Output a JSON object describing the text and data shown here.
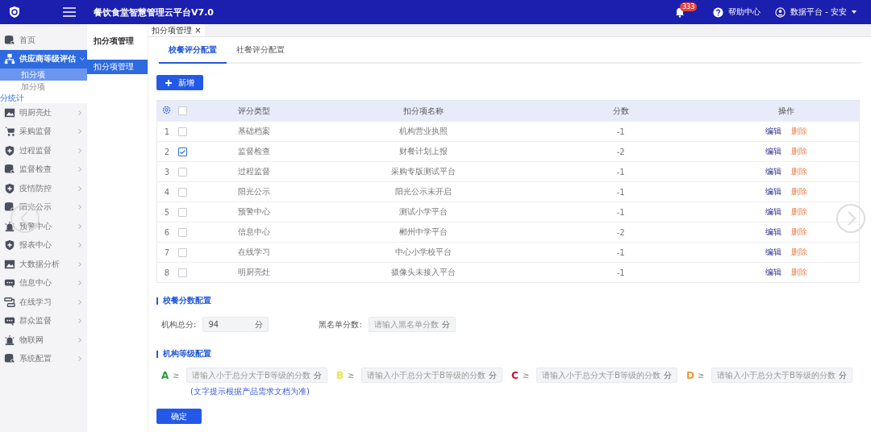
{
  "header": {
    "title": "餐饮食堂智慧管理云平台V7.0",
    "badge": "333",
    "help": "帮助中心",
    "user": "数据平台 - 安安"
  },
  "sidebar": {
    "items": [
      {
        "label": "首页",
        "selected": false
      },
      {
        "label": "供应商等级评估",
        "selected": true,
        "expanded": true,
        "children": [
          {
            "label": "扣分项",
            "selected": true
          },
          {
            "label": "加分项",
            "selected": false
          }
        ]
      },
      {
        "label": "分统计",
        "kind": "fragment",
        "selected": false
      },
      {
        "label": "明厨亮灶",
        "selected": false,
        "expanded": false
      },
      {
        "label": "采购监督",
        "selected": false,
        "expanded": false
      },
      {
        "label": "过程监督",
        "selected": false,
        "expanded": false
      },
      {
        "label": "监督检查",
        "selected": false,
        "expanded": false
      },
      {
        "label": "疫情防控",
        "selected": false,
        "expanded": false
      },
      {
        "label": "阳光公示",
        "selected": false,
        "expanded": false
      },
      {
        "label": "预警中心",
        "selected": false,
        "expanded": false
      },
      {
        "label": "报表中心",
        "selected": false,
        "expanded": false
      },
      {
        "label": "大数据分析",
        "selected": false,
        "expanded": false
      },
      {
        "label": "信息中心",
        "selected": false,
        "expanded": false
      },
      {
        "label": "在线学习",
        "selected": false,
        "expanded": false
      },
      {
        "label": "群众监督",
        "selected": false,
        "expanded": false
      },
      {
        "label": "物联网",
        "selected": false,
        "expanded": false
      },
      {
        "label": "系统配置",
        "selected": false,
        "expanded": false
      }
    ]
  },
  "subnav": {
    "title": "扣分项管理",
    "items": [
      {
        "label": "扣分项管理",
        "selected": true
      }
    ]
  },
  "page_tabs": [
    {
      "label": "扣分项管理",
      "close": "×",
      "selected": true
    }
  ],
  "tabs": [
    {
      "label": "校餐评分配置",
      "selected": true
    },
    {
      "label": "社餐评分配置",
      "selected": false
    }
  ],
  "add_button": "新增",
  "table": {
    "header_checked": false,
    "columns": [
      "评分类型",
      "扣分项名称",
      "分数",
      "操作"
    ],
    "rows": [
      {
        "index": "1",
        "checked": false,
        "type": "基础档案",
        "name": "机构营业执照",
        "score": "-1",
        "edit": "编辑",
        "delete": "删除"
      },
      {
        "index": "2",
        "checked": true,
        "type": "监督检查",
        "name": "财餐计划上报",
        "score": "-2",
        "edit": "编辑",
        "delete": "删除"
      },
      {
        "index": "3",
        "checked": false,
        "type": "过程监督",
        "name": "采购专版测试平台",
        "score": "-1",
        "edit": "编辑",
        "delete": "删除"
      },
      {
        "index": "4",
        "checked": false,
        "type": "阳光公示",
        "name": "阳光公示未开启",
        "score": "-1",
        "edit": "编辑",
        "delete": "删除"
      },
      {
        "index": "5",
        "checked": false,
        "type": "预警中心",
        "name": "测试小学平台",
        "score": "-1",
        "edit": "编辑",
        "delete": "删除"
      },
      {
        "index": "6",
        "checked": false,
        "type": "信息中心",
        "name": "郴州中学平台",
        "score": "-2",
        "edit": "编辑",
        "delete": "删除"
      },
      {
        "index": "7",
        "checked": false,
        "type": "在线学习",
        "name": "中心小学校平台",
        "score": "-1",
        "edit": "编辑",
        "delete": "删除"
      },
      {
        "index": "8",
        "checked": false,
        "type": "明厨亮灶",
        "name": "摄像头未接入平台",
        "score": "-1",
        "edit": "编辑",
        "delete": "删除"
      }
    ]
  },
  "score_section": {
    "title": "校餐分数配置",
    "fields": [
      {
        "label": "机构总分:",
        "value": "94",
        "unit": "分"
      },
      {
        "label": "黑名单分数:",
        "placeholder": "请输入黑名单分数",
        "unit": "分"
      }
    ]
  },
  "grade_section": {
    "title": "机构等级配置",
    "grades": [
      {
        "letter": "A",
        "color": "#22a045",
        "symbol": "≥",
        "placeholder": "请输入小于总分大于B等级的分数",
        "unit": "分",
        "note": "(文字提示根据产品需求文档为准)"
      },
      {
        "letter": "B",
        "color": "#eee24a",
        "symbol": "≥",
        "placeholder": "请输入小于总分大于B等级的分数",
        "unit": "分"
      },
      {
        "letter": "C",
        "color": "#c8102e",
        "symbol": "≥",
        "placeholder": "请输入小于总分大于B等级的分数",
        "unit": "分"
      },
      {
        "letter": "D",
        "color": "#ef9a30",
        "symbol": "≥",
        "placeholder": "请输入小于总分大于B等级的分数",
        "unit": "分"
      }
    ]
  },
  "confirm_button": "确定"
}
